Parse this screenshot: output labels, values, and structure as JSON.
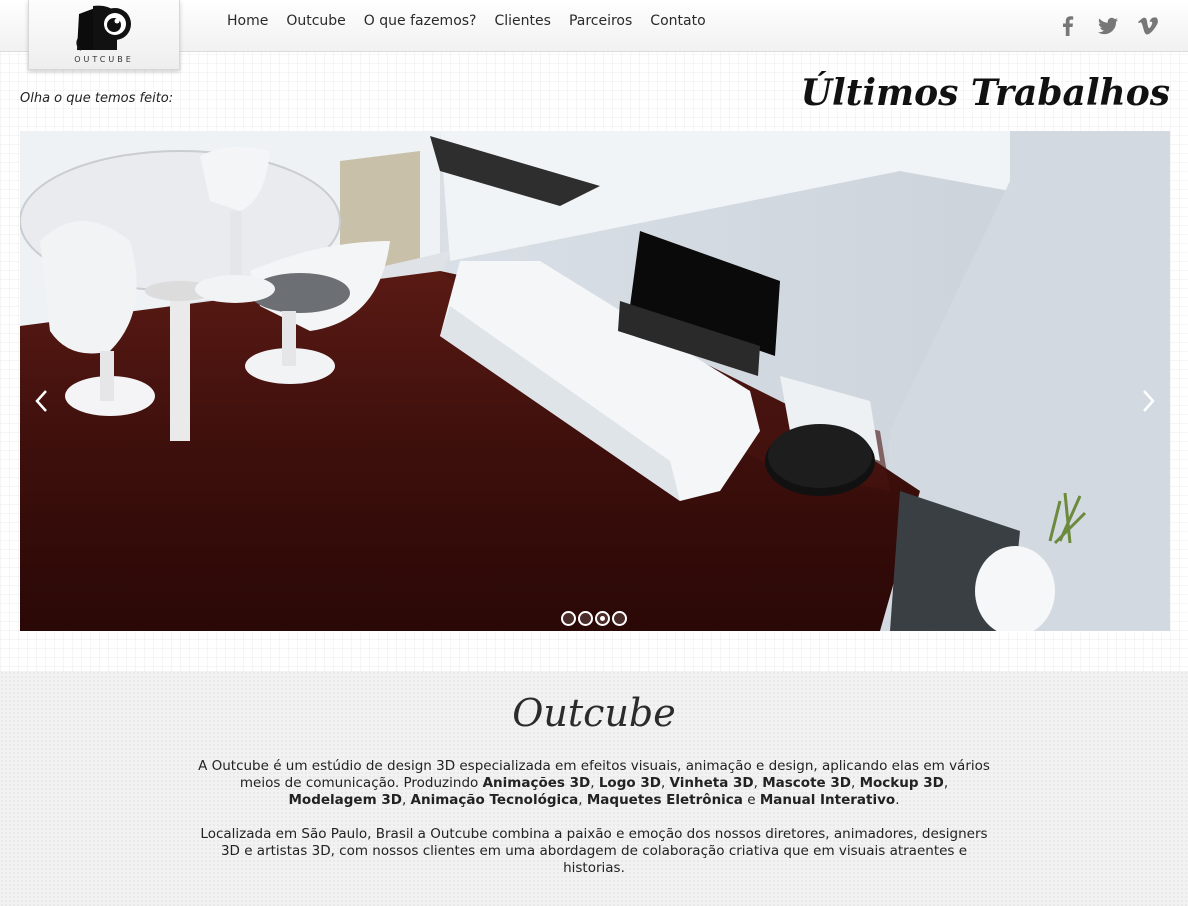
{
  "brand": {
    "name": "OUTCUBE"
  },
  "nav": {
    "items": [
      {
        "label": "Home"
      },
      {
        "label": "Outcube"
      },
      {
        "label": "O que fazemos?"
      },
      {
        "label": "Clientes"
      },
      {
        "label": "Parceiros"
      },
      {
        "label": "Contato"
      }
    ]
  },
  "social": {
    "icons": [
      "facebook-icon",
      "twitter-icon",
      "vimeo-icon"
    ],
    "color": "#777777"
  },
  "works": {
    "subtitle": "Olha o que temos feito:",
    "title": "Últimos Trabalhos"
  },
  "slider": {
    "slide_count": 4,
    "active_index": 2,
    "prev_icon": "chevron-left-icon",
    "next_icon": "chevron-right-icon"
  },
  "about": {
    "title": "Outcube",
    "p1_text_a": "A Outcube é um estúdio de design 3D especializada em efeitos visuais, animação e design, aplicando elas em vários meios de comunicação. Produzindo ",
    "p1_b1": "Animações 3D",
    "p1_s1": ", ",
    "p1_b2": "Logo 3D",
    "p1_s2": ", ",
    "p1_b3": "Vinheta 3D",
    "p1_s3": ", ",
    "p1_b4": "Mascote 3D",
    "p1_s4": ", ",
    "p1_b5": "Mockup 3D",
    "p1_s5": ", ",
    "p1_b6": "Modelagem 3D",
    "p1_s6": ", ",
    "p1_b7": "Animação Tecnológica",
    "p1_s7": ", ",
    "p1_b8": "Maquetes Eletrônica",
    "p1_s8": " e ",
    "p1_b9": "Manual Interativo",
    "p1_end": ".",
    "p2": "Localizada em São Paulo, Brasil a Outcube combina a paixão e emoção dos nossos diretores, animadores, designers 3D e artistas 3D, com nossos clientes em uma abordagem de colaboração criativa que em visuais atraentes e historias."
  }
}
